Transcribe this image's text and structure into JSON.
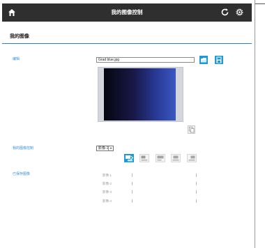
{
  "header": {
    "title": "我的图像控制",
    "icons": {
      "home": "home-icon",
      "refresh": "refresh-icon",
      "settings": "gear-icon"
    },
    "bg_color": "#2f2f2f"
  },
  "page": {
    "title": "我的图像"
  },
  "sections": {
    "edit": {
      "label": "编辑"
    },
    "control": {
      "label": "我的图像控制"
    },
    "memory": {
      "label": "已保存图像"
    }
  },
  "file": {
    "name": "Grad blue.jpg"
  },
  "control": {
    "selected": "影像-1"
  },
  "memory": {
    "rows": [
      {
        "label": "影像-1"
      },
      {
        "label": "影像-2"
      },
      {
        "label": "影像-3"
      },
      {
        "label": "影像-4"
      }
    ]
  },
  "colors": {
    "accent": "#3a8fd0",
    "line": "#2c7fb8",
    "button": "#1e9ad6"
  }
}
